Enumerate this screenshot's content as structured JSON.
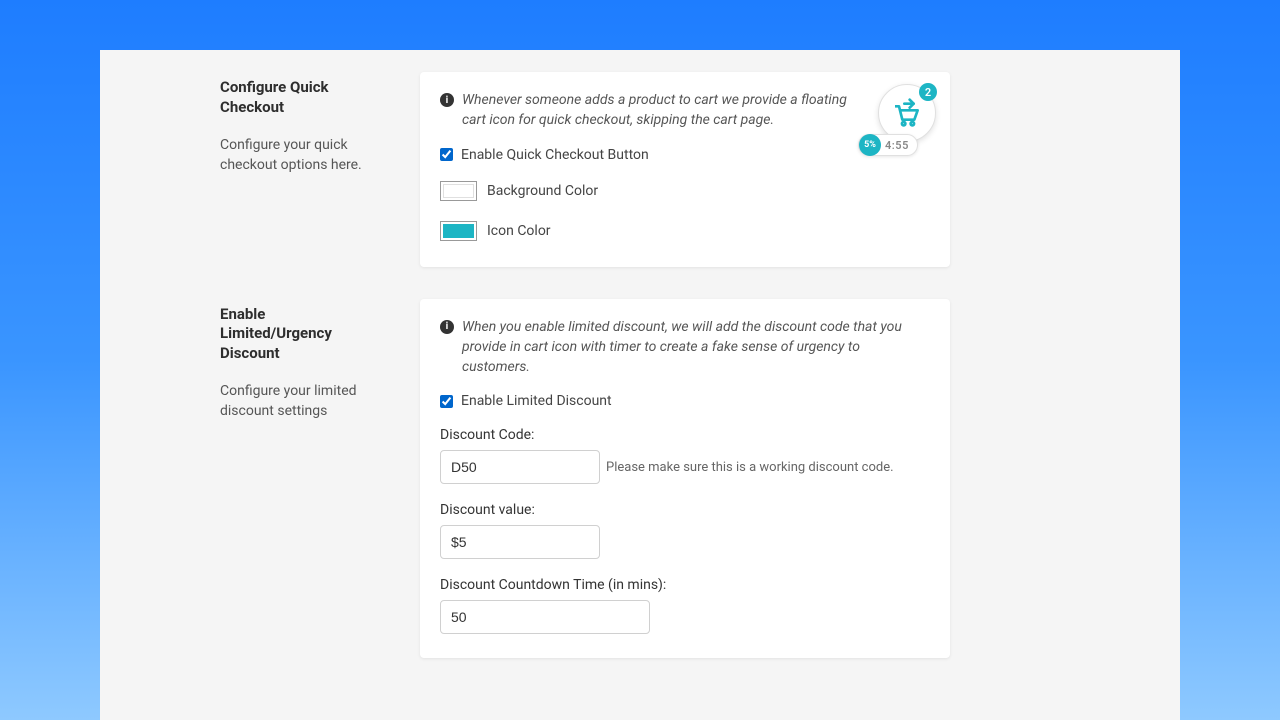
{
  "sections": {
    "quick": {
      "title": "Configure Quick Checkout",
      "desc": "Configure your quick checkout options here.",
      "info": "Whenever someone adds a product to cart we provide a floating cart icon for quick checkout, skipping the cart page.",
      "enable_label": "Enable Quick Checkout Button",
      "bg_label": "Background Color",
      "bg_color": "#ffffff",
      "icon_label": "Icon Color",
      "icon_color": "#1db5c4"
    },
    "urgency": {
      "title": "Enable Limited/Urgency Discount",
      "desc": "Configure your limited discount settings",
      "info": "When you enable limited discount, we will add the discount code that you provide in cart icon with timer to create a fake sense of urgency to customers.",
      "enable_label": "Enable Limited Discount",
      "code_label": "Discount Code:",
      "code_value": "D50",
      "code_hint": "Please make sure this is a working discount code.",
      "value_label": "Discount value:",
      "value_value": "$5",
      "countdown_label": "Discount Countdown Time (in mins):",
      "countdown_value": "50"
    }
  },
  "cart_widget": {
    "badge_count": "2",
    "discount_pct": "5%",
    "timer": "4:55"
  }
}
